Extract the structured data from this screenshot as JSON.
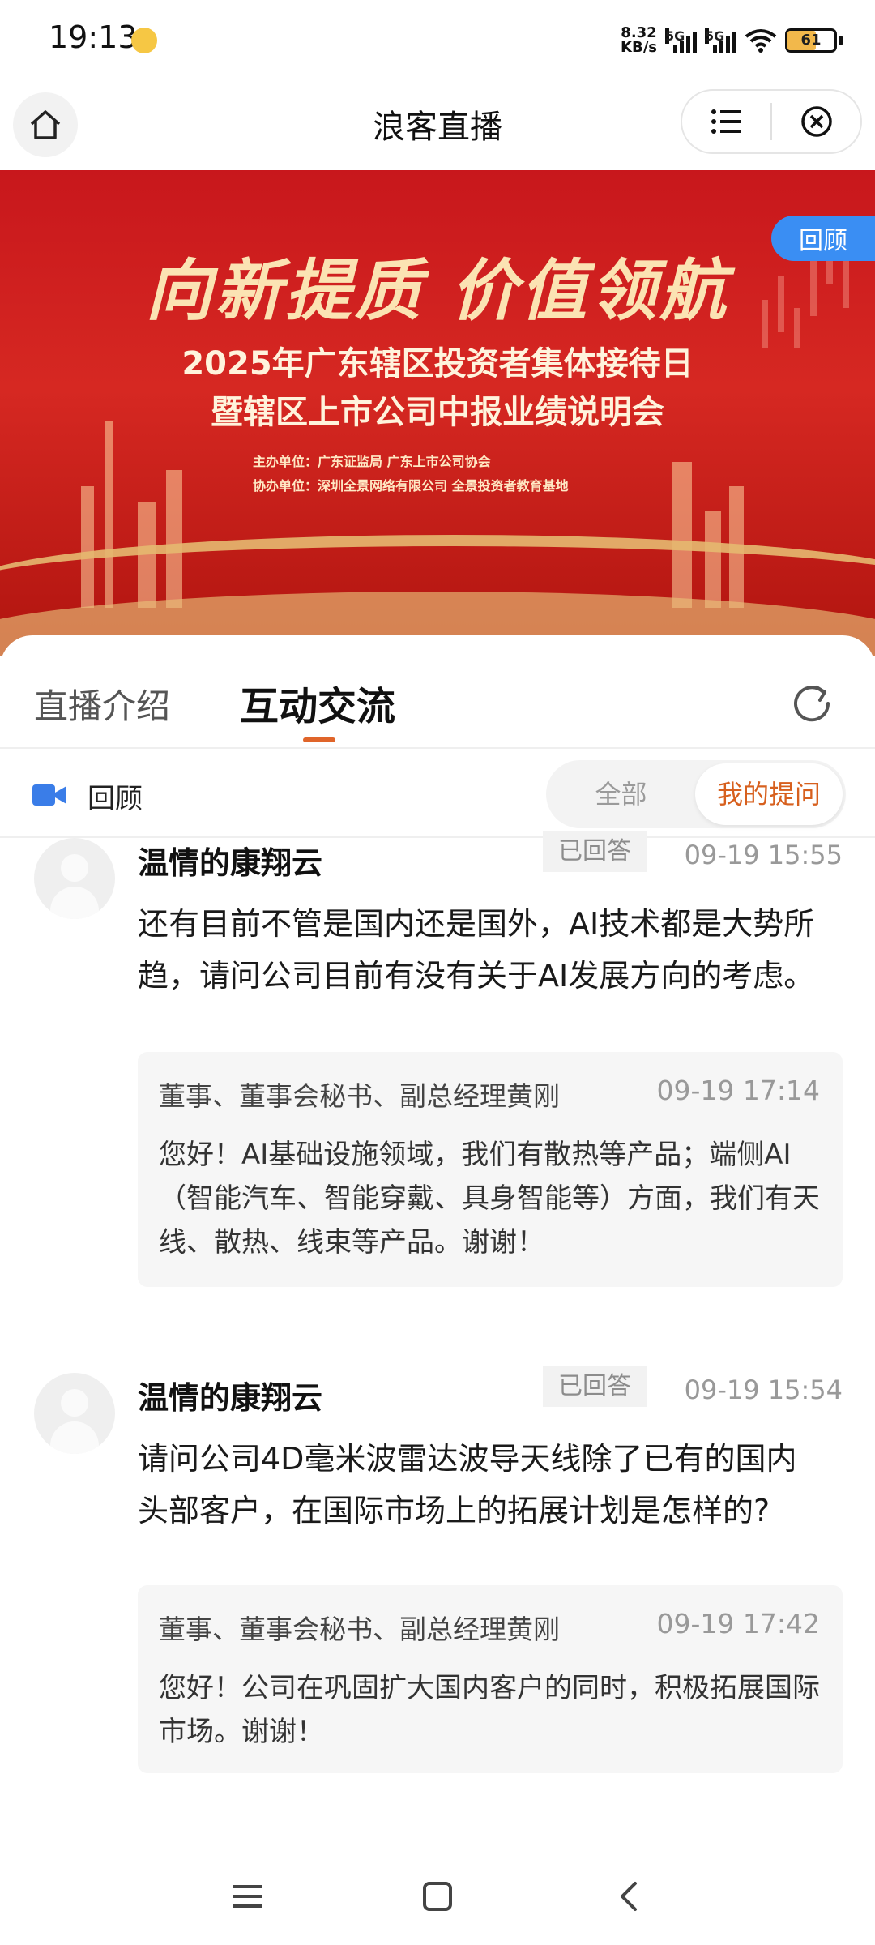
{
  "status_bar": {
    "time": "19:13",
    "net_speed_value": "8.32",
    "net_speed_unit": "KB/s",
    "signal1_label": "5G",
    "signal2_label": "5G",
    "battery": "61"
  },
  "header": {
    "title": "浪客直播"
  },
  "banner": {
    "slogan": "向新提质 价值领航",
    "title_line1": "2025年广东辖区投资者集体接待日",
    "title_line2": "暨辖区上市公司中报业绩说明会",
    "organizer": "主办单位：广东证监局 广东上市公司协会",
    "co_organizer": "协办单位：深圳全景网络有限公司 全景投资者教育基地",
    "badge": "回顾"
  },
  "tabs": {
    "intro": "直播介绍",
    "interact": "互动交流"
  },
  "filter": {
    "label": "回顾",
    "all": "全部",
    "mine": "我的提问"
  },
  "questions": [
    {
      "user": "温情的康翔云",
      "status": "已回答",
      "time": "09-19 15:55",
      "text": "还有目前不管是国内还是国外，AI技术都是大势所趋，请问公司目前有没有关于AI发展方向的考虑。",
      "answer": {
        "responder": "董事、董事会秘书、副总经理黄刚",
        "time": "09-19 17:14",
        "text": "您好！AI基础设施领域，我们有散热等产品；端侧AI（智能汽车、智能穿戴、具身智能等）方面，我们有天线、散热、线束等产品。谢谢！"
      }
    },
    {
      "user": "温情的康翔云",
      "status": "已回答",
      "time": "09-19 15:54",
      "text": "请问公司4D毫米波雷达波导天线除了已有的国内头部客户，在国际市场上的拓展计划是怎样的?",
      "answer": {
        "responder": "董事、董事会秘书、副总经理黄刚",
        "time": "09-19 17:42",
        "text": "您好！公司在巩固扩大国内客户的同时，积极拓展国际市场。谢谢！"
      }
    }
  ],
  "colors": {
    "accent": "#e0652a",
    "badge_blue": "#3a8ef3",
    "banner_red": "#c8171c"
  }
}
